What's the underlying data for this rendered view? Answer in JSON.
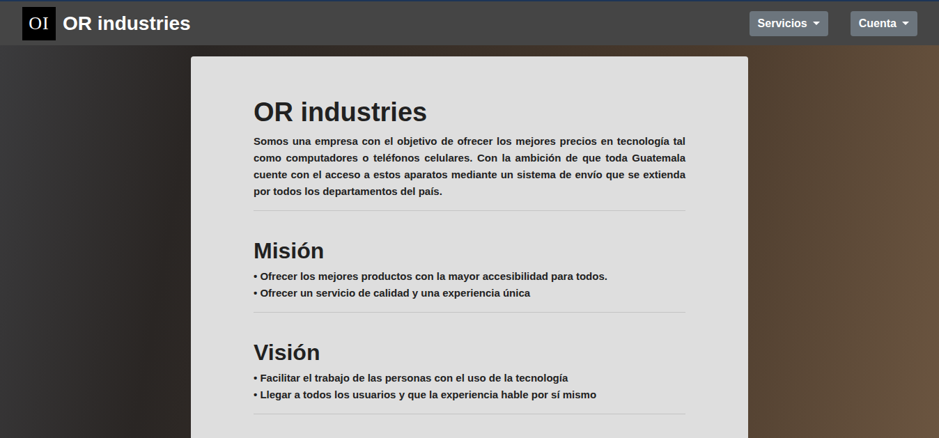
{
  "navbar": {
    "logo": "OI",
    "brand": "OR industries",
    "menus": [
      {
        "label": "Servicios",
        "expanded": false
      },
      {
        "label": "Cuenta",
        "expanded": false
      }
    ]
  },
  "intro": {
    "title": "OR industries",
    "text": "Somos una empresa con el objetivo de ofrecer los mejores precios en tecnología tal como computadores o teléfonos celulares. Con la ambición de que toda Guatemala cuente con el acceso a estos aparatos mediante un sistema de envío que se extienda por todos los departamentos del país."
  },
  "sections": [
    {
      "title": "Misión",
      "items": [
        "• Ofrecer los mejores productos con la mayor accesibilidad para todos.",
        "• Ofrecer un servicio de calidad y una experiencia única"
      ]
    },
    {
      "title": "Visión",
      "items": [
        "• Facilitar el trabajo de las personas con el uso de la tecnología",
        "• Llegar a todos los usuarios y que la experiencia hable por sí mismo"
      ]
    }
  ]
}
